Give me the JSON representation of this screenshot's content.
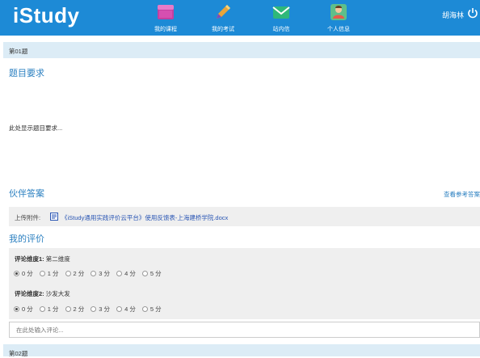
{
  "header": {
    "logo": "iStudy",
    "nav": [
      {
        "label": "我的课程",
        "icon": "folder-icon"
      },
      {
        "label": "我的考试",
        "icon": "pencil-icon"
      },
      {
        "label": "站内信",
        "icon": "mail-icon"
      },
      {
        "label": "个人信息",
        "icon": "user-icon"
      }
    ],
    "username": "胡海林",
    "logout_icon": "power-icon"
  },
  "question1": {
    "band_label": "第01题",
    "requirement_title": "题目要求",
    "requirement_text": "此处显示题目要求...",
    "partner_title": "伙伴答案",
    "reference_link": "查看参考答案",
    "upload_label": "上传附件:",
    "upload_file": "《iStudy通用实践评价云平台》使用反馈表-上海建桥学院.docx",
    "my_eval_title": "我的评价",
    "dimensions": [
      {
        "title": "评论维度1:",
        "name": "第二维度",
        "options": [
          "0 分",
          "1 分",
          "2 分",
          "3 分",
          "4 分",
          "5 分"
        ],
        "selected": 0
      },
      {
        "title": "评论维度2:",
        "name": "沙发大发",
        "options": [
          "0 分",
          "1 分",
          "2 分",
          "3 分",
          "4 分",
          "5 分"
        ],
        "selected": 0
      }
    ],
    "comment_placeholder": "在此处输入评论..."
  },
  "question2": {
    "band_label": "第02题"
  },
  "colors": {
    "header_bg": "#1d8ad6",
    "band_bg": "#dcecf6",
    "section_title": "#2a7fc0",
    "box_bg": "#efefef"
  }
}
